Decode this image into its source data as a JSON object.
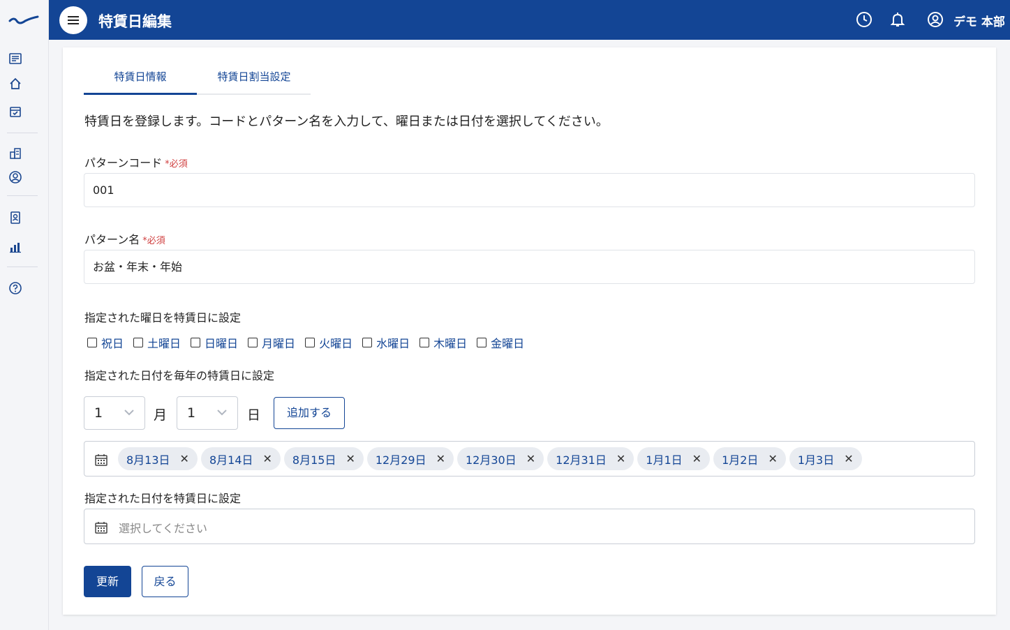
{
  "header": {
    "title": "特賃日編集",
    "user": "デモ 本部"
  },
  "tabs": [
    {
      "label": "特賃日情報"
    },
    {
      "label": "特賃日割当設定"
    }
  ],
  "description": "特賃日を登録します。コードとパターン名を入力して、曜日または日付を選択してください。",
  "form": {
    "code_label": "パターンコード",
    "required_mark": "*必須",
    "code_value": "001",
    "name_label": "パターン名",
    "name_value": "お盆・年末・年始",
    "weekday_label": "指定された曜日を特賃日に設定",
    "weekdays": [
      "祝日",
      "土曜日",
      "日曜日",
      "月曜日",
      "火曜日",
      "水曜日",
      "木曜日",
      "金曜日"
    ],
    "annual_label": "指定された日付を毎年の特賃日に設定",
    "month_value": "1",
    "month_unit": "月",
    "day_value": "1",
    "day_unit": "日",
    "add_label": "追加する",
    "annual_dates": [
      "8月13日",
      "8月14日",
      "8月15日",
      "12月29日",
      "12月30日",
      "12月31日",
      "1月1日",
      "1月2日",
      "1月3日"
    ],
    "remove_mark": "✕",
    "specific_label": "指定された日付を特賃日に設定",
    "specific_placeholder": "選択してください"
  },
  "buttons": {
    "update": "更新",
    "back": "戻る"
  },
  "colors": {
    "primary": "#134595",
    "required": "#d04040"
  }
}
